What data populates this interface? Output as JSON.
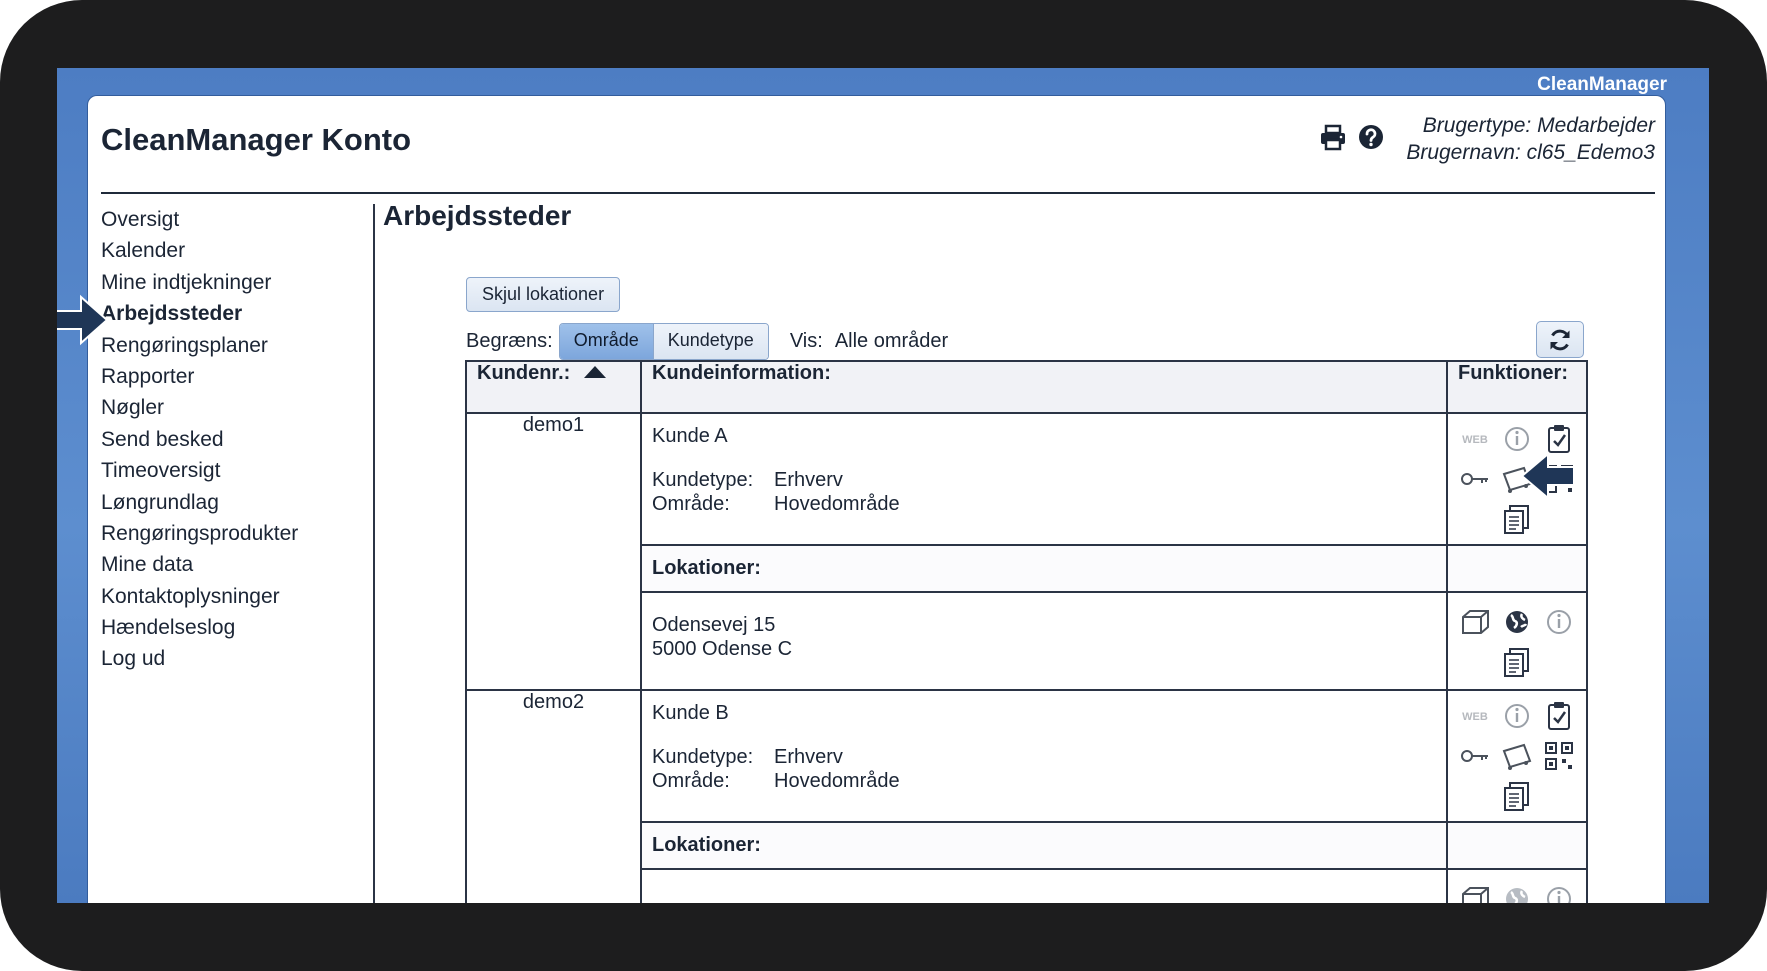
{
  "app": {
    "brand": "CleanManager",
    "title": "CleanManager Konto"
  },
  "user": {
    "type_line": "Brugertype: Medarbejder",
    "name_line": "Brugernavn: cl65_Edemo3"
  },
  "header_icons": [
    "printer-icon",
    "help-icon"
  ],
  "sidebar": {
    "active": "Arbejdssteder",
    "items": [
      {
        "label": "Oversigt"
      },
      {
        "label": "Kalender"
      },
      {
        "label": "Mine indtjekninger"
      },
      {
        "label": "Arbejdssteder"
      },
      {
        "label": "Rengøringsplaner"
      },
      {
        "label": "Rapporter"
      },
      {
        "label": "Nøgler"
      },
      {
        "label": "Send besked"
      },
      {
        "label": "Timeoversigt"
      },
      {
        "label": "Løngrundlag"
      },
      {
        "label": "Rengøringsprodukter"
      },
      {
        "label": "Mine data"
      },
      {
        "label": "Kontaktoplysninger"
      },
      {
        "label": "Hændelseslog"
      },
      {
        "label": "Log ud"
      }
    ]
  },
  "main": {
    "title": "Arbejdssteder",
    "hide_locations_button": "Skjul lokationer",
    "filter": {
      "label": "Begræns:",
      "options": [
        {
          "label": "Område",
          "selected": true
        },
        {
          "label": "Kundetype",
          "selected": false
        }
      ],
      "show_label": "Vis:",
      "show_value": "Alle områder"
    },
    "table": {
      "headers": {
        "kundenr": "Kundenr.:",
        "info": "Kundeinformation:",
        "functions": "Funktioner:"
      },
      "locations_label": "Lokationer:",
      "rows": [
        {
          "kundenr": "demo1",
          "name": "Kunde A",
          "type_label": "Kundetype:",
          "type_value": "Erhverv",
          "area_label": "Område:",
          "area_value": "Hovedområde",
          "location_line1": "Odensevej 15",
          "location_line2": "5000 Odense C"
        },
        {
          "kundenr": "demo2",
          "name": "Kunde B",
          "type_label": "Kundetype:",
          "type_value": "Erhverv",
          "area_label": "Område:",
          "area_value": "Hovedområde",
          "location_line1": "",
          "location_line2": ""
        }
      ]
    }
  },
  "colors": {
    "frame": "#1d1d1e",
    "desktop": "#5d8ecf",
    "selected_segment": "#8fb4e4",
    "text": "#1b2535"
  }
}
